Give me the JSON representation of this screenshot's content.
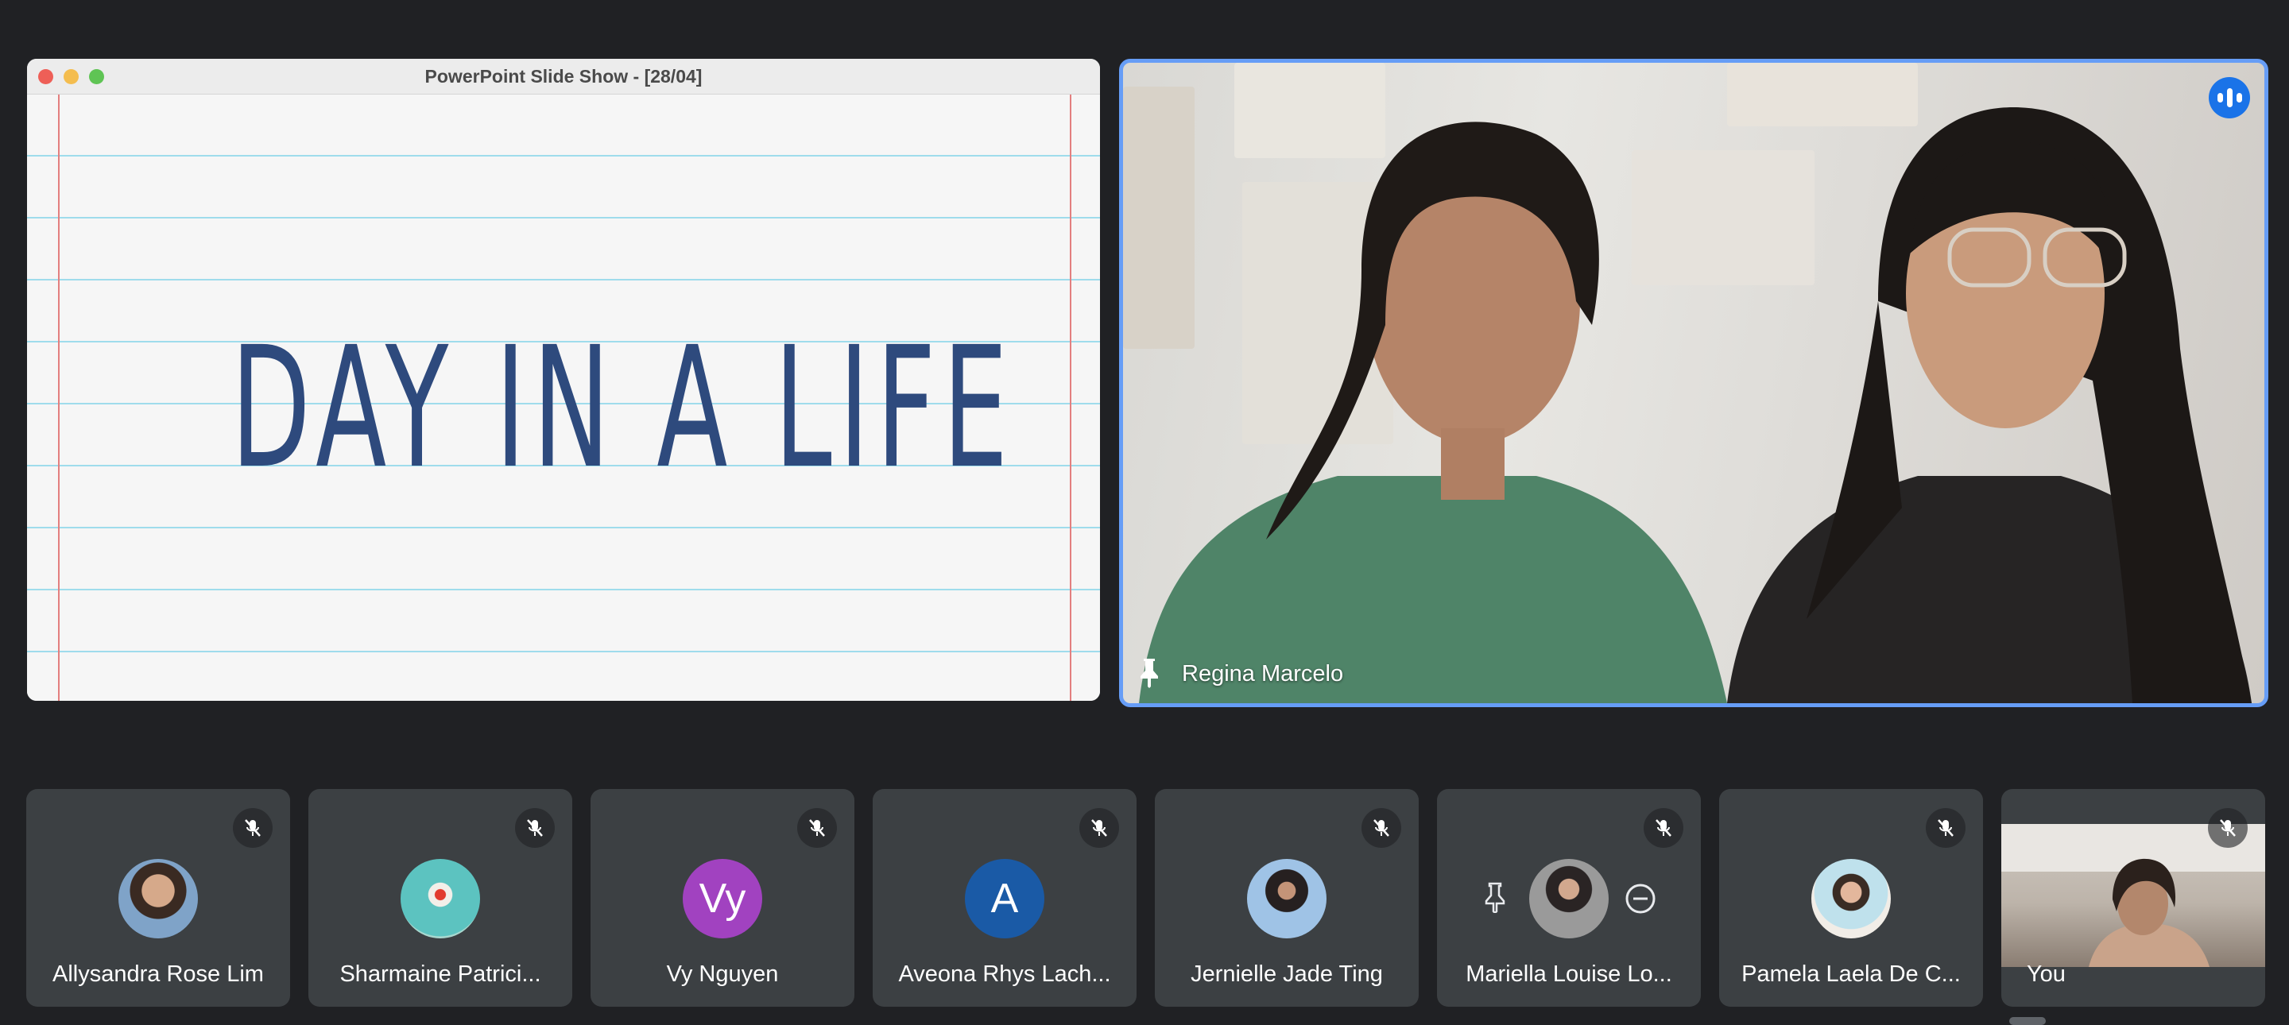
{
  "presentation": {
    "window_title": "PowerPoint Slide Show - [28/04]",
    "slide_title": "DAY IN A LIFE"
  },
  "main_speaker": {
    "name": "Regina Marcelo",
    "pinned": true,
    "speaking": true
  },
  "participants": [
    {
      "name": "Allysandra Rose Lim",
      "avatar": "photo",
      "muted": true
    },
    {
      "name": "Sharmaine Patrici...",
      "avatar": "photo",
      "muted": true
    },
    {
      "name": "Vy Nguyen",
      "avatar": "initials",
      "initials": "Vy",
      "color": "#a142c0",
      "muted": true
    },
    {
      "name": "Aveona Rhys Lach...",
      "avatar": "initials",
      "initials": "A",
      "color": "#1a5aa6",
      "muted": true
    },
    {
      "name": "Jernielle Jade Ting",
      "avatar": "photo",
      "muted": true
    },
    {
      "name": "Mariella Louise Lo...",
      "avatar": "photo",
      "muted": true,
      "hover_controls": [
        "pin-icon",
        "remove-icon"
      ]
    },
    {
      "name": "Pamela Laela De C...",
      "avatar": "photo",
      "muted": true
    },
    {
      "name": "You",
      "avatar": "video",
      "muted": true
    }
  ],
  "colors": {
    "background": "#202124",
    "tile": "#3c4043",
    "active_speaker_border": "#669df6",
    "speaking_badge": "#1a73e8"
  }
}
